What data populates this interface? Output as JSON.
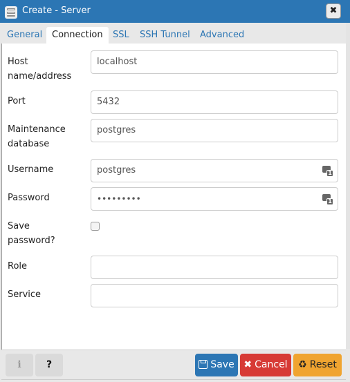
{
  "window": {
    "title": "Create - Server",
    "title_icon": "server-icon",
    "close_glyph": "✖"
  },
  "tabs": [
    {
      "label": "General",
      "active": false
    },
    {
      "label": "Connection",
      "active": true
    },
    {
      "label": "SSL",
      "active": false
    },
    {
      "label": "SSH Tunnel",
      "active": false
    },
    {
      "label": "Advanced",
      "active": false
    }
  ],
  "form": {
    "host": {
      "label_line1": "Host",
      "label_line2": "name/address",
      "value": "localhost"
    },
    "port": {
      "label": "Port",
      "value": "5432"
    },
    "maintenance_db": {
      "label_line1": "Maintenance",
      "label_line2": "database",
      "value": "postgres"
    },
    "username": {
      "label": "Username",
      "value": "postgres",
      "icon": "keyboard-icon"
    },
    "password": {
      "label": "Password",
      "value": "•••••••••",
      "icon": "keyboard-icon"
    },
    "save_password": {
      "label_line1": "Save",
      "label_line2": "password?",
      "checked": false
    },
    "role": {
      "label": "Role",
      "value": ""
    },
    "service": {
      "label": "Service",
      "value": ""
    }
  },
  "footer": {
    "info_glyph": "i",
    "help_glyph": "?",
    "save_label": "Save",
    "cancel_label": "Cancel",
    "cancel_glyph": "✖",
    "reset_label": "Reset",
    "reset_glyph": "♻"
  },
  "colors": {
    "titlebar": "#2c76b4",
    "save": "#2c76b4",
    "cancel": "#d73a35",
    "reset": "#f0a430"
  }
}
